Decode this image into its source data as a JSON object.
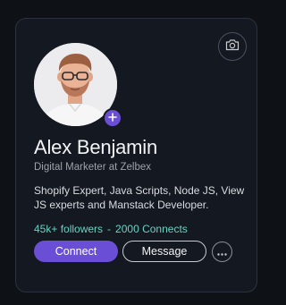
{
  "profile": {
    "name": "Alex Benjamin",
    "role": "Digital Marketer at Zelbex",
    "bio": "Shopify Expert, Java Scripts, Node JS, View JS experts and Manstack Developer.",
    "followers": "45k+ followers",
    "separator": "-",
    "connections": "2000 Connects"
  },
  "actions": {
    "connect_label": "Connect",
    "message_label": "Message"
  },
  "icons": {
    "camera": "camera-icon",
    "add": "plus-icon",
    "more": "more-horizontal-icon"
  },
  "colors": {
    "accent": "#6a4fd6",
    "stats": "#69d2c3",
    "background": "#0e1116",
    "card": "#141820"
  }
}
